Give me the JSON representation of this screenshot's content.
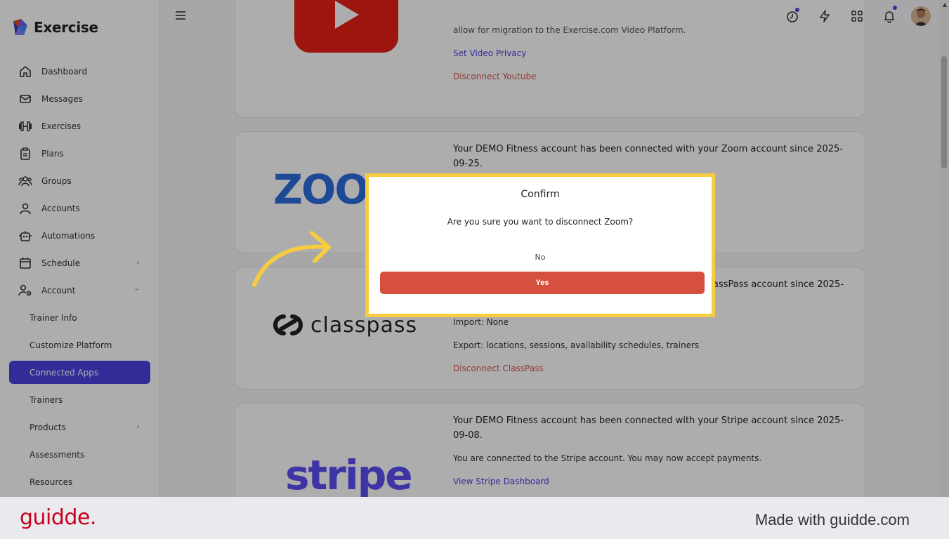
{
  "brand": {
    "name": "Exercise"
  },
  "sidebar": {
    "items": [
      {
        "label": "Dashboard",
        "icon": "home-icon"
      },
      {
        "label": "Messages",
        "icon": "mail-icon"
      },
      {
        "label": "Exercises",
        "icon": "dumbbell-icon"
      },
      {
        "label": "Plans",
        "icon": "clipboard-icon"
      },
      {
        "label": "Groups",
        "icon": "users-icon"
      },
      {
        "label": "Accounts",
        "icon": "user-icon"
      },
      {
        "label": "Automations",
        "icon": "robot-icon"
      },
      {
        "label": "Schedule",
        "icon": "calendar-icon"
      },
      {
        "label": "Account",
        "icon": "user-gear-icon"
      }
    ],
    "sub_items": [
      {
        "label": "Trainer Info"
      },
      {
        "label": "Customize Platform"
      },
      {
        "label": "Connected Apps"
      },
      {
        "label": "Trainers"
      },
      {
        "label": "Products"
      },
      {
        "label": "Assessments"
      },
      {
        "label": "Resources"
      }
    ]
  },
  "cards": {
    "youtube": {
      "fragment": "allow for migration to the Exercise.com Video Platform.",
      "link": "Set Video Privacy",
      "disconnect": "Disconnect Youtube"
    },
    "zoom": {
      "logo": "ZOOM",
      "text": "Your DEMO Fitness account has been connected with your  Zoom account since 2025-09-25."
    },
    "classpass": {
      "logo": "classpass",
      "text_fragment": "assPass account since 2025-",
      "import": "Import: None",
      "export": "Export: locations, sessions, availability schedules, trainers",
      "disconnect": "Disconnect ClassPass"
    },
    "stripe": {
      "logo": "stripe",
      "text": "Your DEMO Fitness account has been connected with your Stripe account since 2025-09-08.",
      "status": "You are connected to the Stripe account. You may now accept payments.",
      "link": "View Stripe Dashboard"
    }
  },
  "dialog": {
    "title": "Confirm",
    "message": "Are you sure you want to disconnect Zoom?",
    "no_label": "No",
    "yes_label": "Yes"
  },
  "footer": {
    "logo": "guidde.",
    "made_with": "Made with guidde.com"
  },
  "colors": {
    "accent": "#4a40e0",
    "danger": "#d65040",
    "highlight": "#f7cd3f",
    "guidde": "#c8001e"
  }
}
